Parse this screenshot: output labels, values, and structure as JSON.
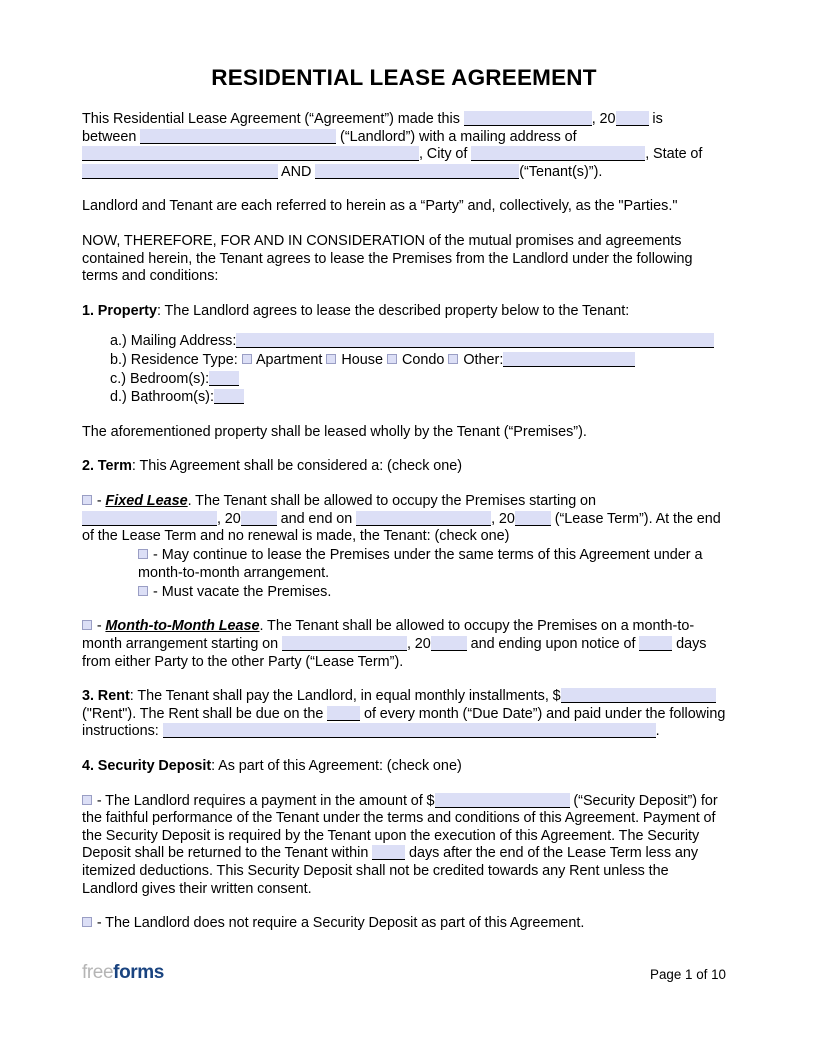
{
  "document": {
    "title": "RESIDENTIAL LEASE AGREEMENT",
    "intro": {
      "p1_a": "This Residential Lease Agreement (“Agreement”) made this",
      "p1_b": ", 20",
      "p1_c": "is",
      "p1_d": "between",
      "p1_e": "(“Landlord”) with a mailing address of",
      "p1_f": ", City of",
      "p1_g": ", State of",
      "p1_h": "AND",
      "p1_i": "(“Tenant(s)”).",
      "parties": "Landlord and Tenant are each referred to herein as a “Party” and, collectively, as the \"Parties.\"",
      "consideration": "NOW, THEREFORE, FOR AND IN CONSIDERATION of the mutual promises and agreements contained herein, the Tenant agrees to lease the Premises from the Landlord under the following terms and conditions:"
    },
    "sections": {
      "property": {
        "number": "1. Property",
        "heading_rest": ": The Landlord agrees to lease the described property below to the Tenant:",
        "items": [
          {
            "marker": "a.)",
            "label": "Mailing Address:"
          },
          {
            "marker": "b.)",
            "label": "Residence Type:"
          },
          {
            "marker": "c.)",
            "label": "Bedroom(s):"
          },
          {
            "marker": "d.)",
            "label": "Bathroom(s):"
          }
        ],
        "residence_options": [
          "Apartment",
          "House",
          "Condo",
          "Other:"
        ],
        "closing": "The aforementioned property shall be leased wholly by the Tenant (“Premises”)."
      },
      "term": {
        "number": "2. Term",
        "heading_rest": ": This Agreement shall be considered a: (check one)",
        "fixed": {
          "dash": "-",
          "label": "Fixed Lease",
          "text_a": ". The Tenant shall be allowed to occupy the Premises starting on",
          "text_b": ", 20",
          "text_c": "and end on",
          "text_d": ", 20",
          "text_e": "(“Lease Term”). At the end of the Lease Term and no renewal is made, the Tenant: (check one)",
          "option_1": "- May continue to lease the Premises under the same terms of this Agreement under a month-to-month arrangement.",
          "option_2": "- Must vacate the Premises."
        },
        "mtm": {
          "dash": "-",
          "label": "Month-to-Month Lease",
          "text_a": ". The Tenant shall be allowed to occupy the Premises on a month-to-month arrangement starting on",
          "text_b": ", 20",
          "text_c": "and ending upon notice of",
          "text_d": "days from either Party to the other Party (“Lease Term”)."
        }
      },
      "rent": {
        "number": "3. Rent",
        "text_a": ": The Tenant shall pay the Landlord, in equal monthly installments, $",
        "text_b": "(\"Rent\"). The Rent shall be due on the",
        "text_c": "of every month (“Due Date”) and paid under the following instructions:",
        "text_d": "."
      },
      "security_deposit": {
        "number": "4. Security Deposit",
        "heading_rest": ": As part of this Agreement: (check one)",
        "option_1": {
          "dash": "-",
          "text_a": "The Landlord requires a payment in the amount of $",
          "text_b": "(“Security Deposit”) for the faithful performance of the Tenant under the terms and conditions of this Agreement. Payment of the Security Deposit is required by the Tenant upon the execution of this Agreement. The Security Deposit shall be returned to the Tenant within",
          "text_c": "days after the end of the Lease Term less any itemized deductions. This Security Deposit shall not be credited towards any Rent unless the Landlord gives their written consent."
        },
        "option_2": {
          "dash": "-",
          "text": "The Landlord does not require a Security Deposit as part of this Agreement."
        }
      }
    },
    "footer": {
      "logo_first": "free",
      "logo_second": "forms",
      "page_number": "Page 1 of 10"
    },
    "colors": {
      "field_fill": "#dcdff6",
      "checkbox_border": "#9a9ec4",
      "logo_gray": "#b5b5b5",
      "logo_blue": "#1a4480"
    }
  }
}
